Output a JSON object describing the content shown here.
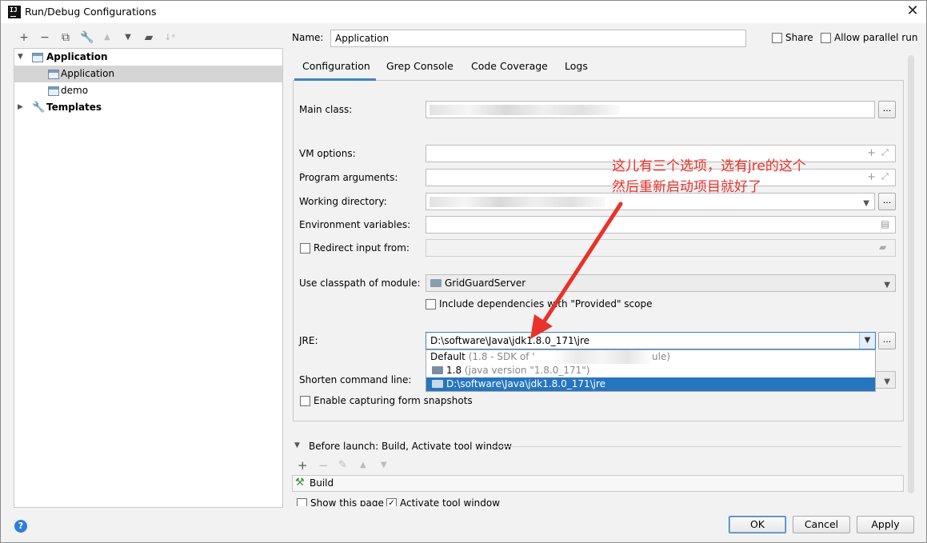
{
  "window": {
    "title": "Run/Debug Configurations"
  },
  "toolbar": {
    "icons": [
      "add-icon",
      "remove-icon",
      "copy-icon",
      "wrench-icon",
      "move-up-icon",
      "move-down-icon",
      "folder-add-icon",
      "sort-icon"
    ]
  },
  "tree": {
    "application": "Application",
    "items": [
      "Application",
      "demo"
    ],
    "templates": "Templates"
  },
  "header": {
    "name_label": "Name:",
    "name_value": "Application",
    "share_label": "Share",
    "parallel_label": "Allow parallel run"
  },
  "tabs": [
    "Configuration",
    "Grep Console",
    "Code Coverage",
    "Logs"
  ],
  "form": {
    "main_class_label": "Main class:",
    "vm_options_label": "VM options:",
    "program_args_label": "Program arguments:",
    "working_dir_label": "Working directory:",
    "env_vars_label": "Environment variables:",
    "redirect_label": "Redirect input from:",
    "classpath_label": "Use classpath of module:",
    "module_value": "GridGuardServer",
    "include_deps_label": "Include dependencies with \"Provided\" scope",
    "jre_label": "JRE:",
    "jre_value": "D:\\software\\Java\\jdk1.8.0_171\\jre",
    "shorten_label": "Shorten command line:",
    "snapshots_label": "Enable capturing form snapshots",
    "ellipsis": "..."
  },
  "jre_dropdown": {
    "default_text": "Default",
    "default_detail_a": "(1.8 - SDK of '",
    "default_detail_b": "ule)",
    "v18_text": "1.8",
    "v18_detail": "(java version \"1.8.0_171\")",
    "selected_text": "D:\\software\\Java\\jdk1.8.0_171\\jre"
  },
  "annotation": {
    "line1": "这儿有三个选项，选有jre的这个",
    "line2": "然后重新启动项目就好了",
    "color": "#e8322a"
  },
  "before_launch": {
    "title": "Before launch: Build, Activate tool window",
    "item": "Build",
    "show_page": "Show this page",
    "activate": "Activate tool window"
  },
  "buttons": {
    "ok": "OK",
    "cancel": "Cancel",
    "apply": "Apply",
    "help": "?"
  }
}
